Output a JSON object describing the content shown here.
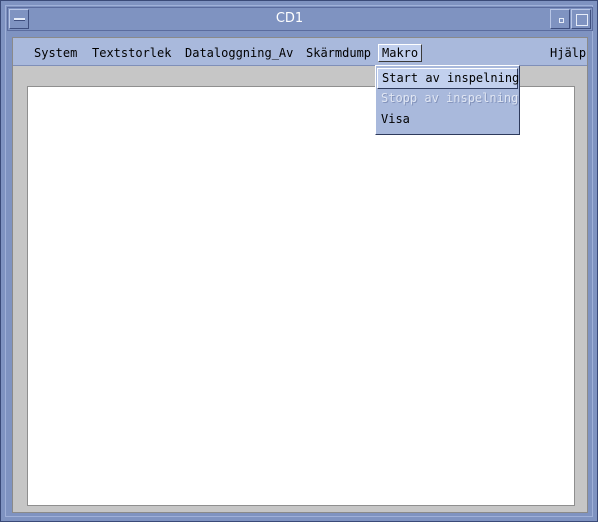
{
  "window": {
    "title": "CD1"
  },
  "menubar": {
    "items": [
      {
        "label": "System"
      },
      {
        "label": "Textstorlek"
      },
      {
        "label": "Dataloggning_Av"
      },
      {
        "label": "Skärmdump"
      },
      {
        "label": "Makro",
        "active": true
      },
      {
        "label": "Hjälp"
      }
    ]
  },
  "makro_menu": {
    "items": [
      {
        "label": "Start av inspelning",
        "state": "highlighted"
      },
      {
        "label": "Stopp av inspelning",
        "state": "disabled"
      },
      {
        "label": "Visa",
        "state": "enabled"
      }
    ]
  }
}
